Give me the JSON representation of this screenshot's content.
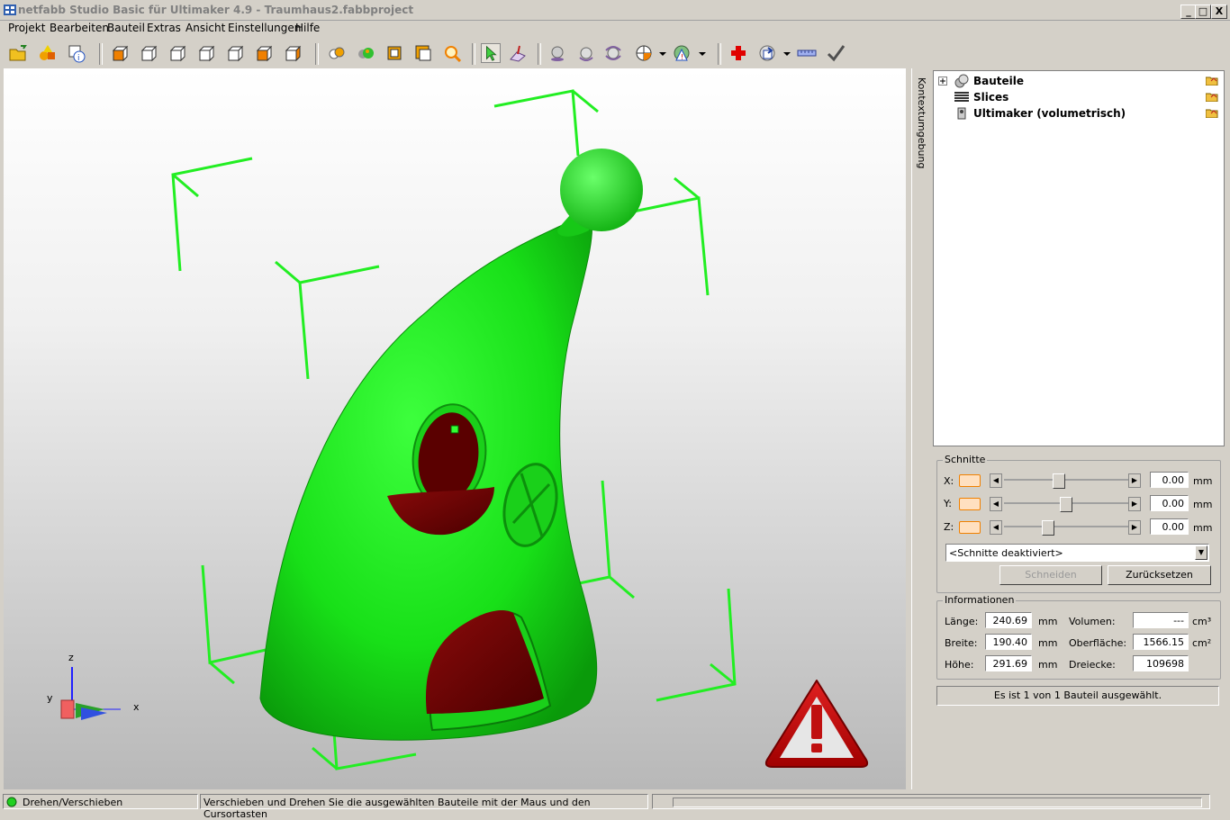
{
  "window": {
    "title": "netfabb Studio Basic für Ultimaker 4.9 - Traumhaus2.fabbproject",
    "btn_min": "_",
    "btn_max": "□",
    "btn_close": "X"
  },
  "menu": [
    "Projekt",
    "Bearbeiten",
    "Bauteil",
    "Extras",
    "Ansicht",
    "Einstellungen",
    "Hilfe"
  ],
  "toolbar": {
    "icons": [
      "open-project-icon",
      "add-part-icon",
      "part-info-icon",
      "view-front-icon",
      "view-back-icon",
      "view-left-icon",
      "view-right-icon",
      "view-top-icon",
      "view-bottom-icon",
      "view-iso-icon",
      "shading-icon",
      "solid-icon",
      "wireframe-icon",
      "box-view-icon",
      "zoom-icon",
      "select-icon",
      "move-icon",
      "sphere-icon",
      "rotate-icon",
      "rotate-multi-icon",
      "section-icon",
      "warning-view-icon",
      "repair-icon",
      "export-icon",
      "measure-icon",
      "checkmark-icon"
    ]
  },
  "viewport": {
    "axis_labels": {
      "x": "x",
      "y": "y",
      "z": "z"
    },
    "model_color": "#11e311",
    "accent_red": "#5a0000"
  },
  "sidetab": {
    "label": "Kontextumgebung"
  },
  "tree": {
    "items": [
      {
        "label": "Bauteile",
        "icon": "parts-icon"
      },
      {
        "label": "Slices",
        "icon": "slices-icon"
      },
      {
        "label": "Ultimaker (volumetrisch)",
        "icon": "printer-icon"
      }
    ]
  },
  "schnitte": {
    "title": "Schnitte",
    "rows": [
      {
        "axis": "X:",
        "value": "0.00",
        "unit": "mm",
        "position": 0.42
      },
      {
        "axis": "Y:",
        "value": "0.00",
        "unit": "mm",
        "position": 0.52
      },
      {
        "axis": "Z:",
        "value": "0.00",
        "unit": "mm",
        "position": 0.36
      }
    ],
    "mode_select": "<Schnitte deaktiviert>",
    "btn_cut": "Schneiden",
    "btn_reset": "Zurücksetzen"
  },
  "info": {
    "title": "Informationen",
    "laenge_label": "Länge:",
    "laenge_value": "240.69",
    "laenge_unit": "mm",
    "breite_label": "Breite:",
    "breite_value": "190.40",
    "breite_unit": "mm",
    "hoehe_label": "Höhe:",
    "hoehe_value": "291.69",
    "hoehe_unit": "mm",
    "volumen_label": "Volumen:",
    "volumen_value": "---",
    "volumen_unit": "cm³",
    "oberflaeche_label": "Oberfläche:",
    "oberflaeche_value": "1566.15",
    "oberflaeche_unit": "cm²",
    "dreiecke_label": "Dreiecke:",
    "dreiecke_value": "109698"
  },
  "selection_status": "Es ist 1 von 1 Bauteil ausgewählt.",
  "status": {
    "mode": "Drehen/Verschieben",
    "hint": "Verschieben und Drehen Sie die ausgewählten Bauteile mit der Maus und den Cursortasten"
  }
}
